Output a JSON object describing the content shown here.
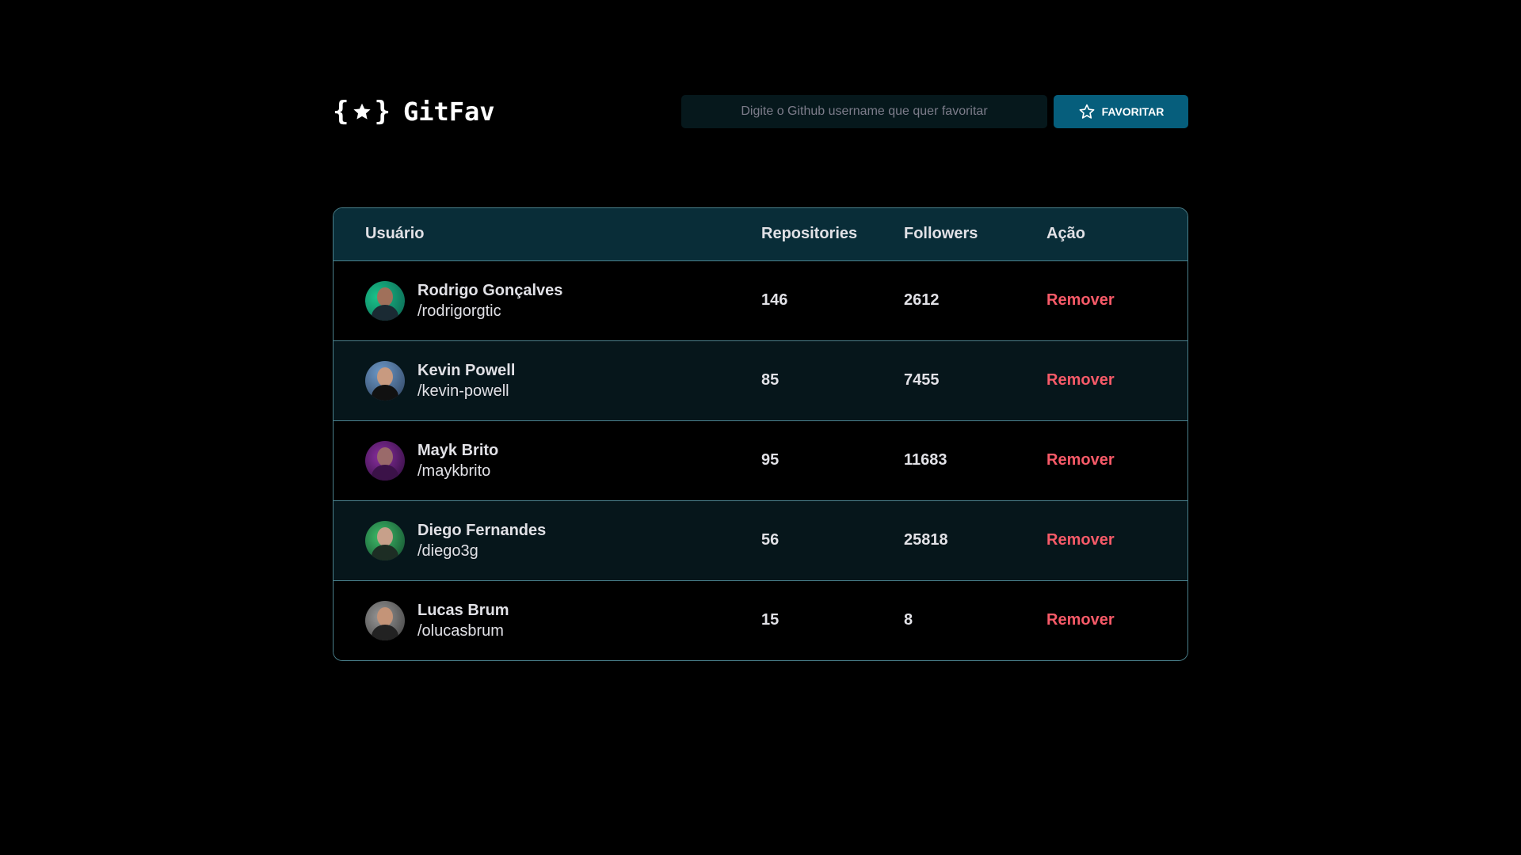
{
  "header": {
    "logo_text": "GitFav",
    "search": {
      "placeholder": "Digite o Github username que quer favoritar",
      "value": ""
    },
    "favorite_button_label": "FAVORITAR"
  },
  "table": {
    "columns": {
      "user": "Usuário",
      "repositories": "Repositories",
      "followers": "Followers",
      "action": "Ação"
    },
    "rows": [
      {
        "name": "Rodrigo Gonçalves",
        "login": "/rodrigorgtic",
        "repositories": "146",
        "followers": "2612",
        "action": "Remover"
      },
      {
        "name": "Kevin Powell",
        "login": "/kevin-powell",
        "repositories": "85",
        "followers": "7455",
        "action": "Remover"
      },
      {
        "name": "Mayk Brito",
        "login": "/maykbrito",
        "repositories": "95",
        "followers": "11683",
        "action": "Remover"
      },
      {
        "name": "Diego Fernandes",
        "login": "/diego3g",
        "repositories": "56",
        "followers": "25818",
        "action": "Remover"
      },
      {
        "name": "Lucas Brum",
        "login": "/olucasbrum",
        "repositories": "15",
        "followers": "8",
        "action": "Remover"
      }
    ]
  },
  "colors": {
    "background": "#000000",
    "header_row": "#092D38",
    "alt_row": "#06161B",
    "border": "#4A808C",
    "button": "#065E7C",
    "remove": "#F75A68",
    "input_bg": "#06181C"
  },
  "icons": {
    "logo": "braces-star-icon",
    "favorite": "star-outline-icon"
  }
}
